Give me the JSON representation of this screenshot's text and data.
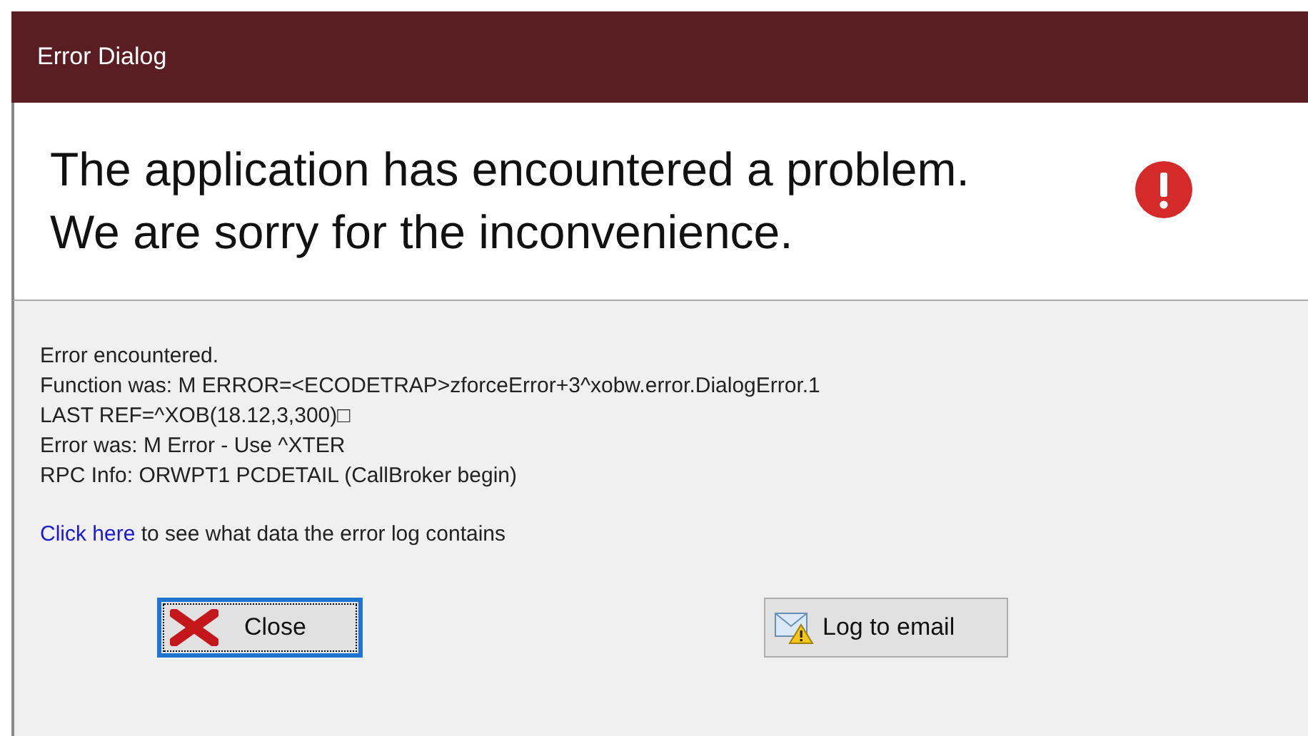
{
  "window": {
    "title": "Error Dialog"
  },
  "header": {
    "lines": [
      "The application has encountered a problem.",
      "We are sorry for the inconvenience."
    ]
  },
  "details": [
    "Error encountered.",
    "Function was: M  ERROR=<ECODETRAP>zforceError+3^xobw.error.DialogError.1",
    "LAST REF=^XOB(18.12,3,300)□",
    "Error was: M Error - Use ^XTER",
    "RPC Info: ORWPT1 PCDETAIL (CallBroker begin)"
  ],
  "log_link": {
    "link": "Click here",
    "text": "to see what data the error log contains"
  },
  "buttons": [
    {
      "label": "Close",
      "kind": "close",
      "focused": true
    },
    {
      "label": "Log to email",
      "kind": "email",
      "focused": false
    }
  ]
}
